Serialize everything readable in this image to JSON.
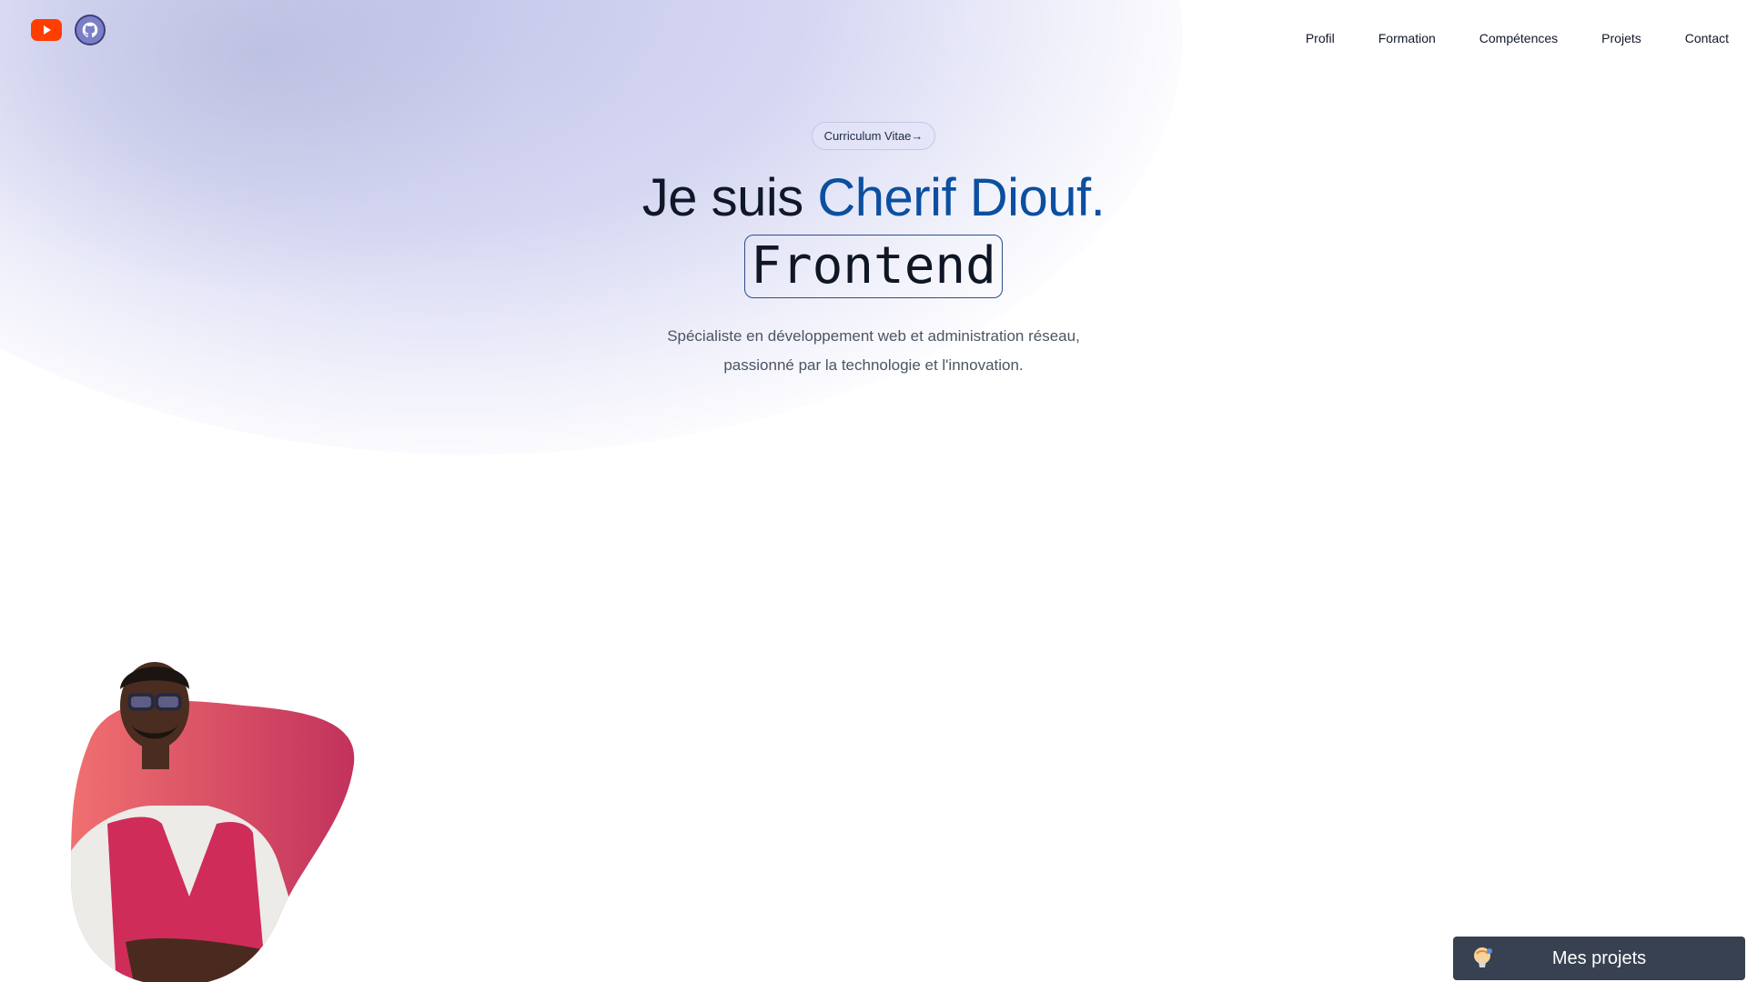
{
  "header": {
    "social": [
      {
        "name": "youtube",
        "icon": "youtube-icon",
        "color": "#ff3d00"
      },
      {
        "name": "github",
        "icon": "github-icon",
        "color": "#7b7fc8"
      }
    ],
    "nav": [
      "Profil",
      "Formation",
      "Compétences",
      "Projets",
      "Contact"
    ]
  },
  "hero": {
    "cv_label": "Curriculum Vitae",
    "cv_arrow": "→",
    "title_prefix": "Je suis ",
    "title_name": "Cherif Diouf.",
    "role": "Frontend",
    "description": "Spécialiste en développement web et administration réseau, passionné par la technologie et l'innovation."
  },
  "floating_button": {
    "label": "Mes projets",
    "icon": "lightbulb-icon"
  },
  "colors": {
    "accent": "#0b4fa0",
    "button_bg": "#374151",
    "avatar_blob_start": "#f07070",
    "avatar_blob_end": "#c2325c"
  }
}
